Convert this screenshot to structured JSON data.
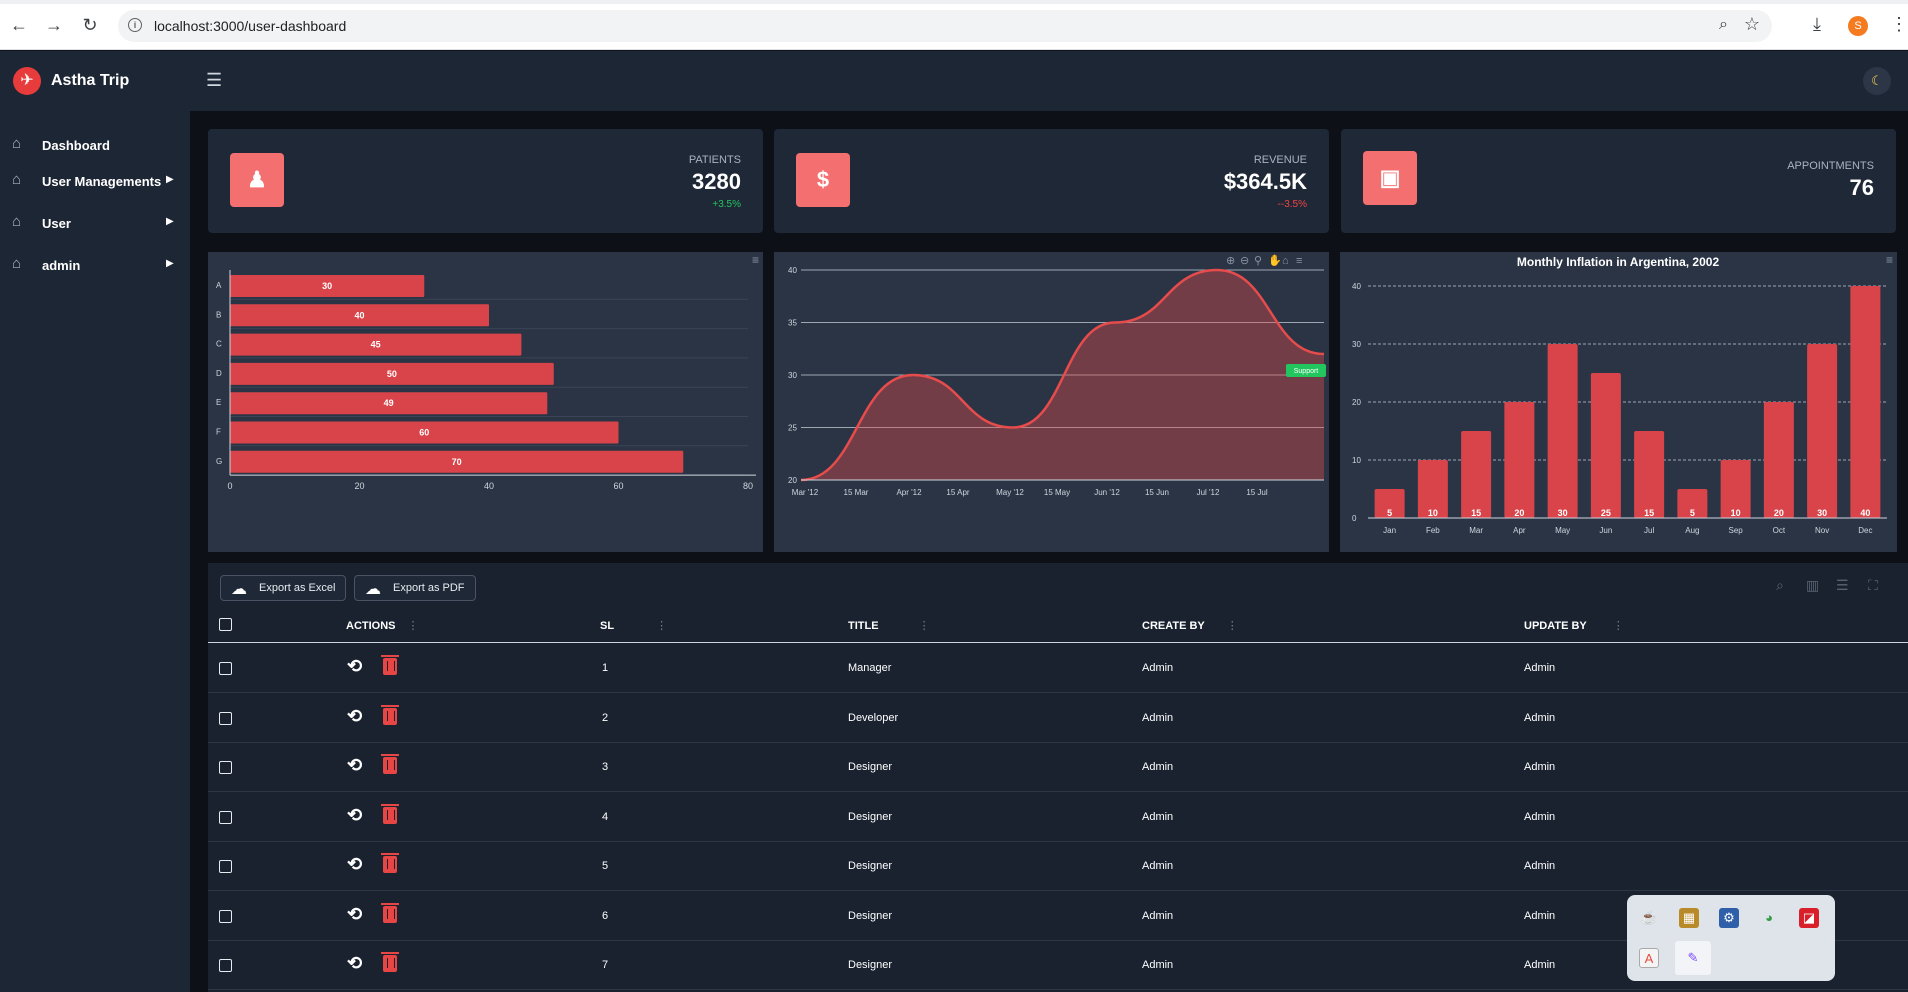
{
  "browser": {
    "url": "localhost:3000/user-dashboard",
    "profile_initial": "S"
  },
  "app": {
    "brand": "Astha Trip"
  },
  "sidebar": {
    "items": [
      {
        "label": "Dashboard",
        "has_submenu": false
      },
      {
        "label": "User Managements",
        "has_submenu": true
      },
      {
        "label": "User",
        "has_submenu": true
      },
      {
        "label": "admin",
        "has_submenu": true
      }
    ]
  },
  "stats": [
    {
      "label": "PATIENTS",
      "value": "3280",
      "delta": "+3.5%",
      "delta_color": "#22c55e",
      "icon": "user-icon"
    },
    {
      "label": "REVENUE",
      "value": "$364.5K",
      "delta": "--3.5%",
      "delta_color": "#ef4444",
      "icon": "dollar-icon"
    },
    {
      "label": "APPOINTMENTS",
      "value": "76",
      "delta": "",
      "delta_color": "#aab3c0",
      "icon": "calendar-check-icon"
    }
  ],
  "chart_data": [
    {
      "type": "bar",
      "orientation": "horizontal",
      "categories": [
        "A",
        "B",
        "C",
        "D",
        "E",
        "F",
        "G"
      ],
      "values": [
        30,
        40,
        45,
        50,
        49,
        60,
        70
      ],
      "xlim": [
        0,
        80
      ],
      "xticks": [
        "0",
        "20",
        "40",
        "60",
        "80"
      ],
      "color": "#d9444a"
    },
    {
      "type": "area",
      "x_labels": [
        "Mar '12",
        "15 Mar",
        "Apr '12",
        "15 Apr",
        "May '12",
        "15 May",
        "Jun '12",
        "15 Jun",
        "Jul '12",
        "15 Jul"
      ],
      "points": [
        [
          "Mar '12",
          20
        ],
        [
          "Apr '12",
          30
        ],
        [
          "May '12",
          25
        ],
        [
          "Jun '12",
          35
        ],
        [
          "Jul '12",
          40
        ],
        [
          "end",
          32
        ]
      ],
      "ylim": [
        20,
        40
      ],
      "yticks": [
        "20",
        "25",
        "30",
        "35",
        "40"
      ],
      "annotation": "Support",
      "color": "#e74c4c"
    },
    {
      "type": "bar",
      "title": "Monthly Inflation in Argentina, 2002",
      "categories": [
        "Jan",
        "Feb",
        "Mar",
        "Apr",
        "May",
        "Jun",
        "Jul",
        "Aug",
        "Sep",
        "Oct",
        "Nov",
        "Dec"
      ],
      "values": [
        5,
        10,
        15,
        20,
        30,
        25,
        15,
        5,
        10,
        20,
        30,
        40
      ],
      "ylim": [
        0,
        40
      ],
      "yticks": [
        "0",
        "10",
        "20",
        "30",
        "40"
      ],
      "color": "#d9444a"
    }
  ],
  "table": {
    "export_excel": "Export as Excel",
    "export_pdf": "Export as PDF",
    "headers": {
      "actions": "ACTIONS",
      "sl": "SL",
      "title": "TITLE",
      "create_by": "CREATE BY",
      "update_by": "UPDATE BY"
    },
    "rows": [
      {
        "sl": "1",
        "title": "Manager",
        "create_by": "Admin",
        "update_by": "Admin"
      },
      {
        "sl": "2",
        "title": "Developer",
        "create_by": "Admin",
        "update_by": "Admin"
      },
      {
        "sl": "3",
        "title": "Designer",
        "create_by": "Admin",
        "update_by": "Admin"
      },
      {
        "sl": "4",
        "title": "Designer",
        "create_by": "Admin",
        "update_by": "Admin"
      },
      {
        "sl": "5",
        "title": "Designer",
        "create_by": "Admin",
        "update_by": "Admin"
      },
      {
        "sl": "6",
        "title": "Designer",
        "create_by": "Admin",
        "update_by": "Admin"
      },
      {
        "sl": "7",
        "title": "Designer",
        "create_by": "Admin",
        "update_by": "Admin"
      }
    ]
  },
  "colors": {
    "accent": "#f47070",
    "bar": "#d9444a",
    "sidebar_bg": "#1d2634",
    "card_bg": "#1f2836"
  }
}
